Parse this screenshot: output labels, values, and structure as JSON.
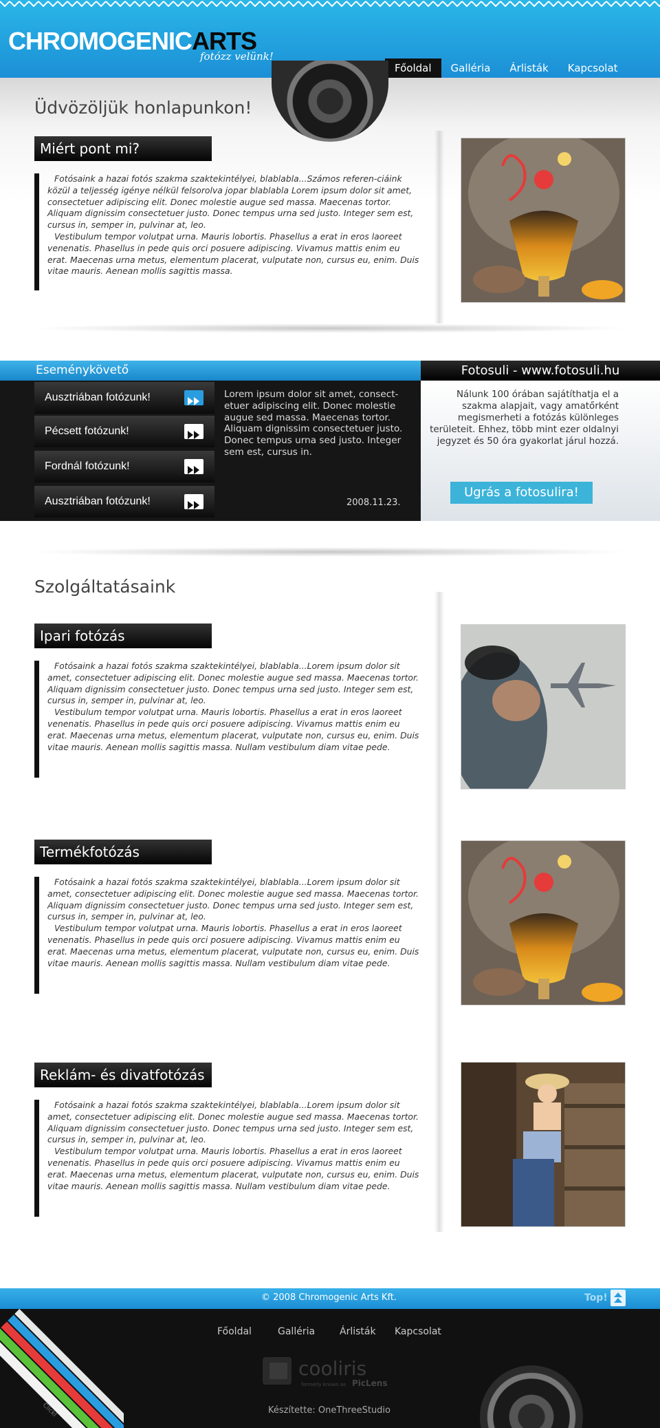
{
  "header": {
    "logo_part1": "CHROMOGENIC",
    "logo_part2": "ARTS",
    "tagline": "fotózz velünk!",
    "nav": [
      "Főoldal",
      "Galléria",
      "Árlisták",
      "Kapcsolat"
    ],
    "active_nav": "Főoldal"
  },
  "welcome": {
    "title": "Üdvözöljük honlapunkon!",
    "section_title": "Miért pont mi?",
    "p1": "Fotósaink a hazai fotós szakma szaktekintélyei, blablabla...Számos referen-ciáink közül a teljesség igénye nélkül felsorolva jopar blablabla Lorem ipsum dolor sit amet, consectetuer adipiscing elit. Donec molestie augue sed massa. Maecenas tortor. Aliquam dignissim consectetuer justo. Donec tempus urna sed justo. Integer sem est, cursus in, semper in, pulvinar at, leo.",
    "p2": "Vestibulum tempor volutpat urna. Mauris lobortis. Phasellus a erat in eros laoreet venenatis. Phasellus in pede quis orci posuere adipiscing. Vivamus mattis enim eu erat. Maecenas urna metus, elementum placerat, vulputate non, cursus eu, enim. Duis vitae mauris. Aenean mollis sagittis massa."
  },
  "events": {
    "title": "Eseménykövető",
    "items": [
      "Ausztriában fotózunk!",
      "Pécsett fotózunk!",
      "Fordnál fotózunk!",
      "Ausztriában fotózunk!"
    ],
    "text": "Lorem ipsum dolor sit amet, consect-etuer adipiscing elit. Donec molestie augue sed massa. Maecenas tortor. Aliquam dignissim consectetuer justo. Donec tempus urna sed justo. Integer sem est, cursus in.",
    "date": "2008.11.23."
  },
  "fotosuli": {
    "title": "Fotosuli - www.fotosuli.hu",
    "text": "Nálunk 100 órában sajátíthatja el a szakma alapjait, vagy amatőrként megismerheti a fotózás különleges területeit. Ehhez, több mint ezer oldalnyi jegyzet és 50 óra gyakorlat járul hozzá.",
    "button": "Ugrás a fotosulira!"
  },
  "services": {
    "title": "Szolgáltatásaink",
    "items": [
      {
        "title": "Ipari fotózás",
        "p1": "Fotósaink a hazai fotós szakma szaktekintélyei, blablabla...Lorem ipsum dolor sit amet, consectetuer adipiscing elit. Donec molestie augue sed massa. Maecenas tortor. Aliquam dignissim consectetuer justo. Donec tempus urna sed justo. Integer sem est, cursus in, semper in, pulvinar at, leo.",
        "p2": "Vestibulum tempor volutpat urna. Mauris lobortis. Phasellus a erat in eros laoreet venenatis. Phasellus in pede quis orci posuere adipiscing. Vivamus mattis enim eu erat. Maecenas urna metus, elementum placerat, vulputate non, cursus eu, enim. Duis vitae mauris. Aenean mollis sagittis massa. Nullam vestibulum diam vitae pede."
      },
      {
        "title": "Termékfotózás",
        "p1": "Fotósaink a hazai fotós szakma szaktekintélyei, blablabla...Lorem ipsum dolor sit amet, consectetuer adipiscing elit. Donec molestie augue sed massa. Maecenas tortor. Aliquam dignissim consectetuer justo. Donec tempus urna sed justo. Integer sem est, cursus in, semper in, pulvinar at, leo.",
        "p2": "Vestibulum tempor volutpat urna. Mauris lobortis. Phasellus a erat in eros laoreet venenatis. Phasellus in pede quis orci posuere adipiscing. Vivamus mattis enim eu erat. Maecenas urna metus, elementum placerat, vulputate non, cursus eu, enim. Duis vitae mauris. Aenean mollis sagittis massa. Nullam vestibulum diam vitae pede."
      },
      {
        "title": "Reklám- és divatfotózás",
        "p1": "Fotósaink a hazai fotós szakma szaktekintélyei, blablabla...Lorem ipsum dolor sit amet, consectetuer adipiscing elit. Donec molestie augue sed massa. Maecenas tortor. Aliquam dignissim consectetuer justo. Donec tempus urna sed justo. Integer sem est, cursus in, semper in, pulvinar at, leo.",
        "p2": "Vestibulum tempor volutpat urna. Mauris lobortis. Phasellus a erat in eros laoreet venenatis. Phasellus in pede quis orci posuere adipiscing. Vivamus mattis enim eu erat. Maecenas urna metus, elementum placerat, vulputate non, cursus eu, enim. Duis vitae mauris. Aenean mollis sagittis massa. Nullam vestibulum diam vitae pede."
      }
    ]
  },
  "footer": {
    "copyright": "© 2008 Chromogenic Arts Kft.",
    "top_label": "Top!",
    "nav": [
      "Főoldal",
      "Galléria",
      "Árlisták",
      "Kapcsolat"
    ],
    "cooliris_name": "cooliris",
    "cooliris_sub": "formerly known as",
    "cooliris_brand": "PicLens",
    "stripe_label": "Clickl",
    "credit": "Készítette: OneThreeStudio"
  },
  "colors": {
    "brand_blue": "#1c8fd6",
    "accent_cyan": "#3cb3d9",
    "dark": "#111111"
  }
}
